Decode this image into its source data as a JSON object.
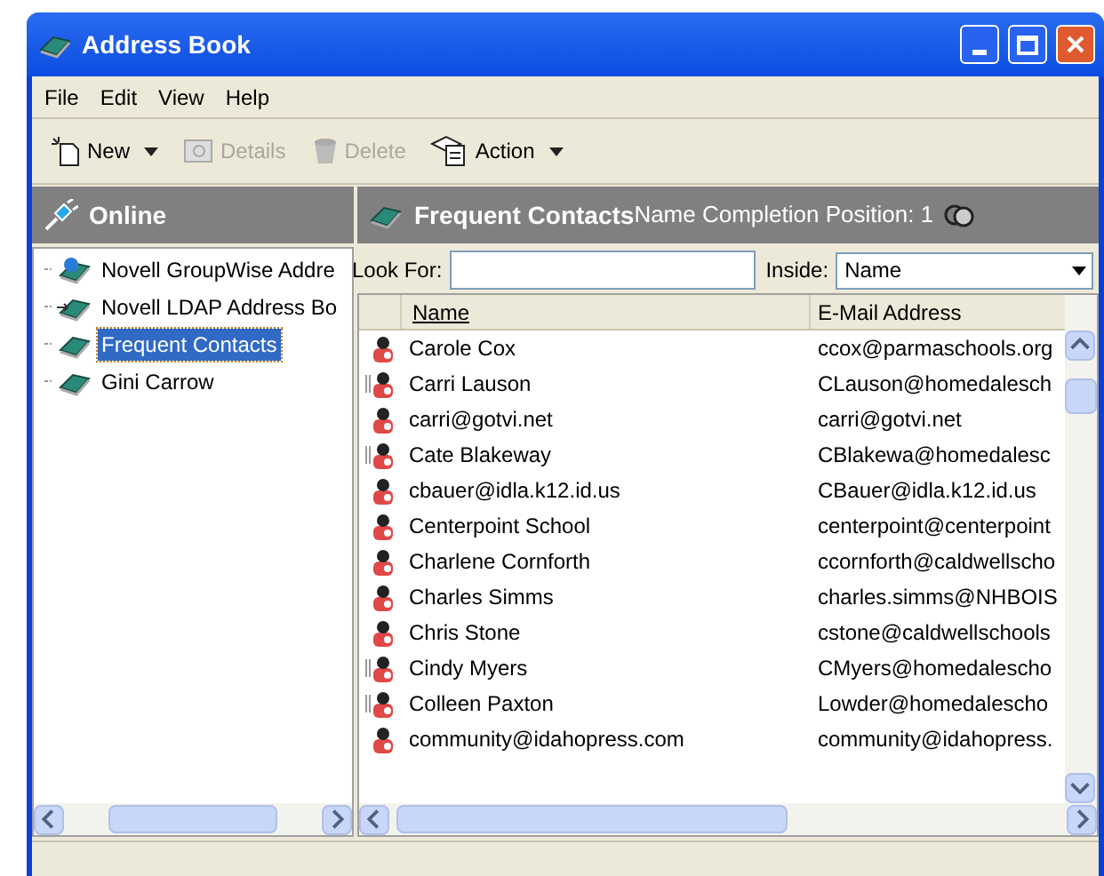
{
  "window": {
    "title": "Address Book"
  },
  "menu": [
    "File",
    "Edit",
    "View",
    "Help"
  ],
  "toolbar": [
    {
      "label": "New",
      "disabled": false,
      "dropdown": true,
      "kind": "new"
    },
    {
      "label": "Details",
      "disabled": true,
      "dropdown": false,
      "kind": "details"
    },
    {
      "label": "Delete",
      "disabled": true,
      "dropdown": false,
      "kind": "delete"
    },
    {
      "label": "Action",
      "disabled": false,
      "dropdown": true,
      "kind": "action"
    }
  ],
  "left_panel": {
    "title": "Online",
    "items": [
      {
        "label": "Novell GroupWise Addre",
        "kind": "globe",
        "selected": false
      },
      {
        "label": "Novell LDAP Address Bo",
        "kind": "ldap",
        "selected": false
      },
      {
        "label": "Frequent Contacts",
        "kind": "book",
        "selected": true
      },
      {
        "label": "Gini Carrow",
        "kind": "book",
        "selected": false
      }
    ]
  },
  "right_panel": {
    "title": "Frequent Contacts",
    "subtitle": "Name Completion Position:  1",
    "look_for": {
      "label": "Look For:"
    },
    "inside": {
      "label": "Inside:",
      "value": "Name"
    },
    "columns": [
      "Name",
      "E-Mail Address"
    ],
    "rows": [
      {
        "name": "Carole Cox",
        "email": "ccox@parmaschools.org",
        "linked": false
      },
      {
        "name": "Carri Lauson",
        "email": "CLauson@homedalesch",
        "linked": true
      },
      {
        "name": "carri@gotvi.net",
        "email": "carri@gotvi.net",
        "linked": false
      },
      {
        "name": "Cate Blakeway",
        "email": "CBlakewa@homedalesc",
        "linked": true
      },
      {
        "name": "cbauer@idla.k12.id.us",
        "email": "CBauer@idla.k12.id.us",
        "linked": false
      },
      {
        "name": "Centerpoint School",
        "email": "centerpoint@centerpoint",
        "linked": false
      },
      {
        "name": "Charlene Cornforth",
        "email": "ccornforth@caldwellscho",
        "linked": false
      },
      {
        "name": "Charles Simms",
        "email": "charles.simms@NHBOIS",
        "linked": false
      },
      {
        "name": "Chris Stone",
        "email": "cstone@caldwellschools",
        "linked": false
      },
      {
        "name": "Cindy Myers",
        "email": "CMyers@homedalescho",
        "linked": true
      },
      {
        "name": "Colleen Paxton",
        "email": "Lowder@homedalescho",
        "linked": true
      },
      {
        "name": "community@idahopress.com",
        "email": "community@idahopress.",
        "linked": false
      }
    ]
  }
}
